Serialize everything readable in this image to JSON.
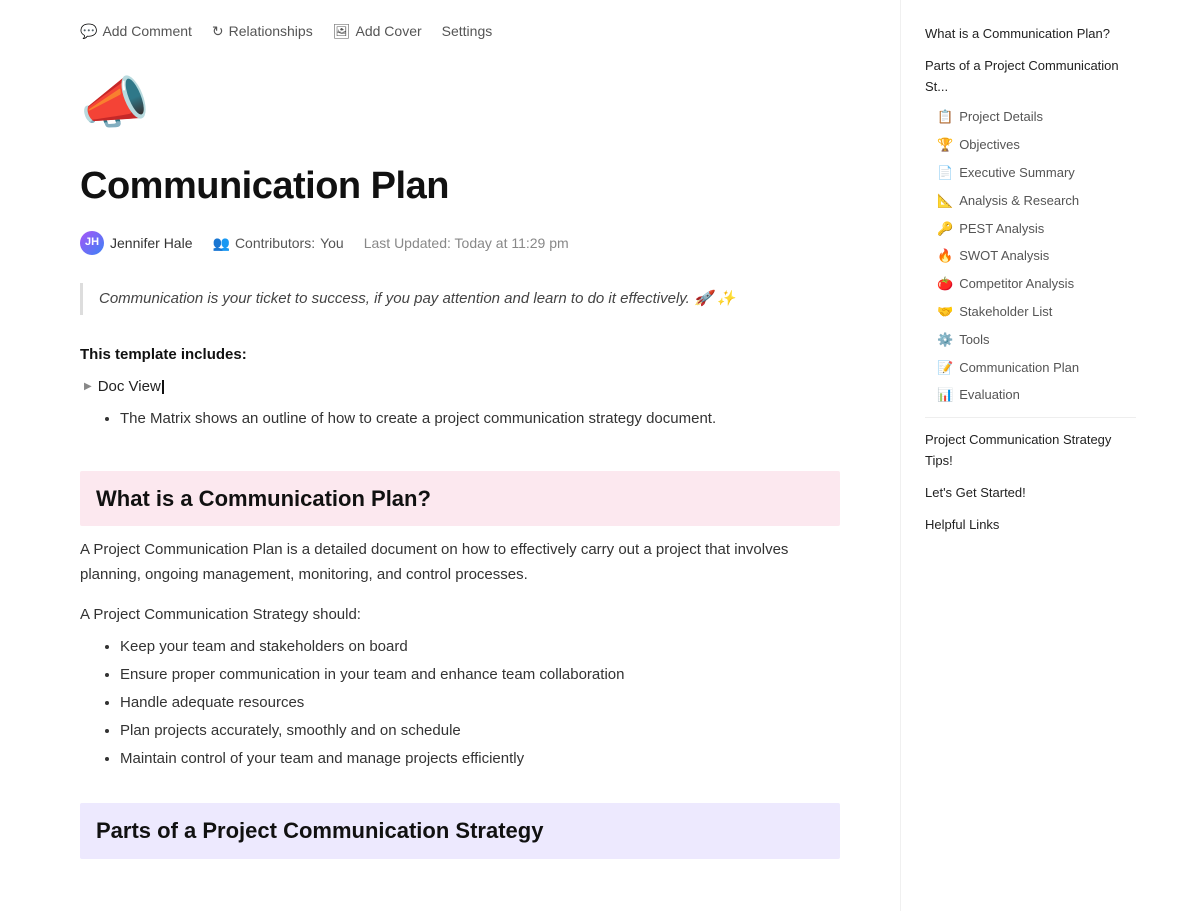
{
  "toolbar": {
    "add_comment": "Add Comment",
    "relationships": "Relationships",
    "add_cover": "Add Cover",
    "settings": "Settings"
  },
  "page": {
    "icon": "📣",
    "title": "Communication Plan",
    "author": "Jennifer Hale",
    "contributors_label": "Contributors:",
    "contributors_value": "You",
    "last_updated_label": "Last Updated:",
    "last_updated_value": "Today at 11:29 pm"
  },
  "quote": "Communication is your ticket to success, if you pay attention and learn to do it effectively. 🚀 ✨",
  "template": {
    "label": "This template includes:",
    "doc_view": "Doc View"
  },
  "doc_view_bullet": "The Matrix shows an outline of how to create a project communication strategy document.",
  "section1": {
    "heading": "What is a Communication Plan?",
    "body1": "A Project Communication Plan is a detailed document on how to effectively carry out a project that involves planning, ongoing management, monitoring, and control processes.",
    "strategy_label": "A Project Communication Strategy should:",
    "bullets": [
      "Keep your team and stakeholders on board",
      "Ensure proper communication in your team and enhance team collaboration",
      "Handle adequate resources",
      "Plan projects accurately, smoothly and on schedule",
      "Maintain control of your team and manage projects efficiently"
    ]
  },
  "section2": {
    "heading": "Parts of a Project Communication Strategy"
  },
  "sidebar": {
    "item_what": "What is a Communication Plan?",
    "item_parts": "Parts of a Project Communication St...",
    "sub_items": [
      {
        "emoji": "📋",
        "label": "Project Details"
      },
      {
        "emoji": "🏆",
        "label": "Objectives"
      },
      {
        "emoji": "📄",
        "label": "Executive Summary"
      },
      {
        "emoji": "📐",
        "label": "Analysis & Research"
      },
      {
        "emoji": "🔑",
        "label": "PEST Analysis"
      },
      {
        "emoji": "🔥",
        "label": "SWOT Analysis"
      },
      {
        "emoji": "🍅",
        "label": "Competitor Analysis"
      },
      {
        "emoji": "🤝",
        "label": "Stakeholder List"
      },
      {
        "emoji": "⚙️",
        "label": "Tools"
      },
      {
        "emoji": "📝",
        "label": "Communication Plan"
      },
      {
        "emoji": "📊",
        "label": "Evaluation"
      }
    ],
    "item_tips": "Project Communication Strategy Tips!",
    "item_started": "Let's Get Started!",
    "item_links": "Helpful Links"
  }
}
